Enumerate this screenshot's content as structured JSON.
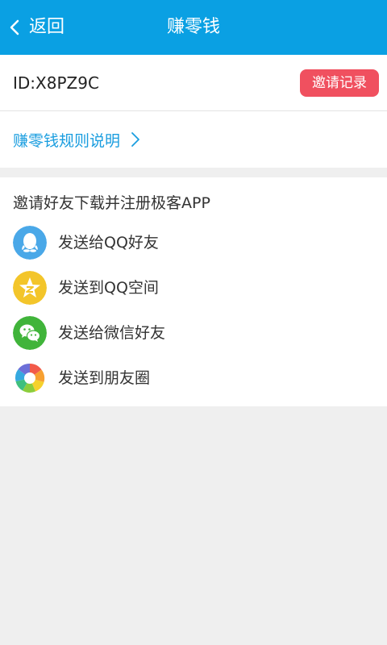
{
  "header": {
    "back_label": "返回",
    "title": "赚零钱"
  },
  "account": {
    "id_text": "ID:X8PZ9C",
    "invite_record_label": "邀请记录"
  },
  "rules": {
    "label": "赚零钱规则说明"
  },
  "share": {
    "heading": "邀请好友下载并注册极客APP",
    "items": [
      {
        "label": "发送给QQ好友",
        "icon": "qq-icon"
      },
      {
        "label": "发送到QQ空间",
        "icon": "qzone-icon"
      },
      {
        "label": "发送给微信好友",
        "icon": "wechat-icon"
      },
      {
        "label": "发送到朋友圈",
        "icon": "moments-icon"
      }
    ]
  },
  "colors": {
    "header_bg": "#0aa0e3",
    "invite_button": "#f0505f",
    "link_blue": "#199ddf",
    "qq": "#4aa8e8",
    "qzone": "#f3c52a",
    "wechat": "#40b43a"
  }
}
